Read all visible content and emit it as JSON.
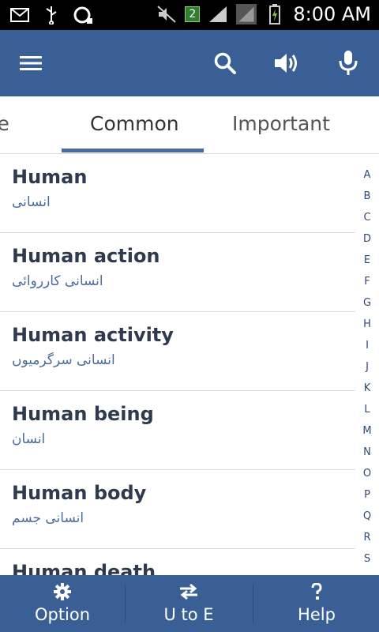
{
  "status_bar": {
    "time": "8:00 AM",
    "sim_slot": "2"
  },
  "app_bar": {
    "menu_icon": "hamburger-menu-icon",
    "search_icon": "search-icon",
    "speaker_icon": "speaker-icon",
    "mic_icon": "microphone-icon"
  },
  "tabs": [
    {
      "label": "Home"
    },
    {
      "label": "Common",
      "active": true
    },
    {
      "label": "Important"
    }
  ],
  "words": [
    {
      "en": "Human",
      "ur": "انسانی"
    },
    {
      "en": "Human action",
      "ur": "انسانی کارروائی"
    },
    {
      "en": "Human activity",
      "ur": "انسانی سرگرمیوں"
    },
    {
      "en": "Human being",
      "ur": "انسان"
    },
    {
      "en": "Human body",
      "ur": "انسانی جسم"
    },
    {
      "en": "Human death",
      "ur": ""
    }
  ],
  "alphabet": [
    "A",
    "B",
    "C",
    "D",
    "E",
    "F",
    "G",
    "H",
    "I",
    "J",
    "K",
    "L",
    "M",
    "N",
    "O",
    "P",
    "Q",
    "R",
    "S"
  ],
  "bottom_bar": {
    "option": {
      "label": "Option",
      "icon": "gear-icon"
    },
    "swap": {
      "label": "U to E",
      "icon": "swap-arrows-icon"
    },
    "help": {
      "label": "Help",
      "icon": "question-mark-icon"
    }
  },
  "colors": {
    "primary": "#3a5f95",
    "accent": "#4a6c9b",
    "text": "#2e3b4e"
  }
}
